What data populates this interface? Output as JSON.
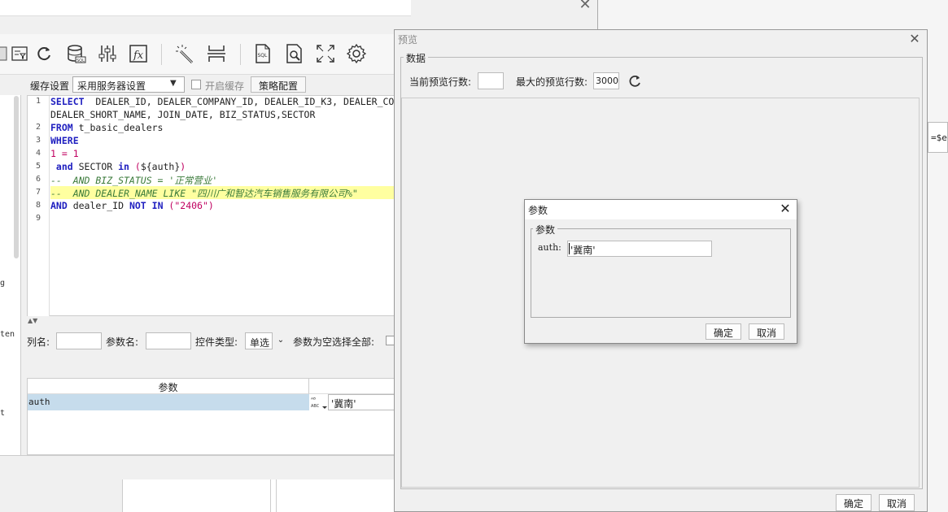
{
  "main": {
    "cache": {
      "label": "缓存设置",
      "select_value": "采用服务器设置",
      "enable_label": "开启缓存",
      "strategy_button": "策略配置"
    },
    "left_panel_fragments": [
      "g",
      "ten",
      "t"
    ],
    "code": {
      "line_numbers": [
        "1",
        "",
        "2",
        "3",
        "4",
        "5",
        "6",
        "7",
        "8",
        "9"
      ],
      "l1_kw": "SELECT",
      "l1_rest": "  DEALER_ID, DEALER_COMPANY_ID, DEALER_ID_K3, DEALER_CO",
      "l1b": "DEALER_SHORT_NAME, JOIN_DATE, BIZ_STATUS,SECTOR",
      "l2_kw": "FROM",
      "l2_rest": " t_basic_dealers",
      "l3_kw": "WHERE",
      "l4": "1 = 1",
      "l5_kw1": " and",
      "l5_mid": " SECTOR ",
      "l5_kw2": "in",
      "l5_paren_open": " (",
      "l5_var": "${auth}",
      "l5_paren_close": ")",
      "l6": "--  AND BIZ_STATUS = '正常营业'",
      "l7": "--  AND DEALER_NAME LIKE \"四川广和智达汽车销售服务有限公司%\"",
      "l8_kw1": "AND",
      "l8_mid": " dealer_ID ",
      "l8_kw2": "NOT IN",
      "l8_paren_open": " (",
      "l8_str": "\"2406\"",
      "l8_paren_close": ")"
    },
    "param_row": {
      "column_label": "列名:",
      "param_name_label": "参数名:",
      "widget_type_label": "控件类型:",
      "widget_type_value": "单选",
      "empty_select_all_label": "参数为空选择全部:"
    },
    "param_table": {
      "header": "参数",
      "row_name": "auth",
      "row_type_icon": "ABC",
      "row_value": "'冀南'"
    }
  },
  "background": {
    "right_field_text": "=$er"
  },
  "preview": {
    "title": "预览",
    "data_group_label": "数据",
    "current_rows_label": "当前预览行数:",
    "current_rows_value": "",
    "max_rows_label": "最大的预览行数:",
    "max_rows_value": "3000",
    "ok": "确定",
    "cancel": "取消"
  },
  "param_dialog": {
    "title": "参数",
    "group_label": "参数",
    "auth_label": "auth:",
    "auth_value": "'冀南'",
    "ok": "确定",
    "cancel": "取消"
  },
  "icons": [
    "filter-icon",
    "refresh-icon",
    "database-icon",
    "sliders-icon",
    "function-icon",
    "magic-wand-icon",
    "page-break-icon",
    "sql-file-icon",
    "search-document-icon",
    "fullscreen-icon",
    "gear-icon"
  ]
}
